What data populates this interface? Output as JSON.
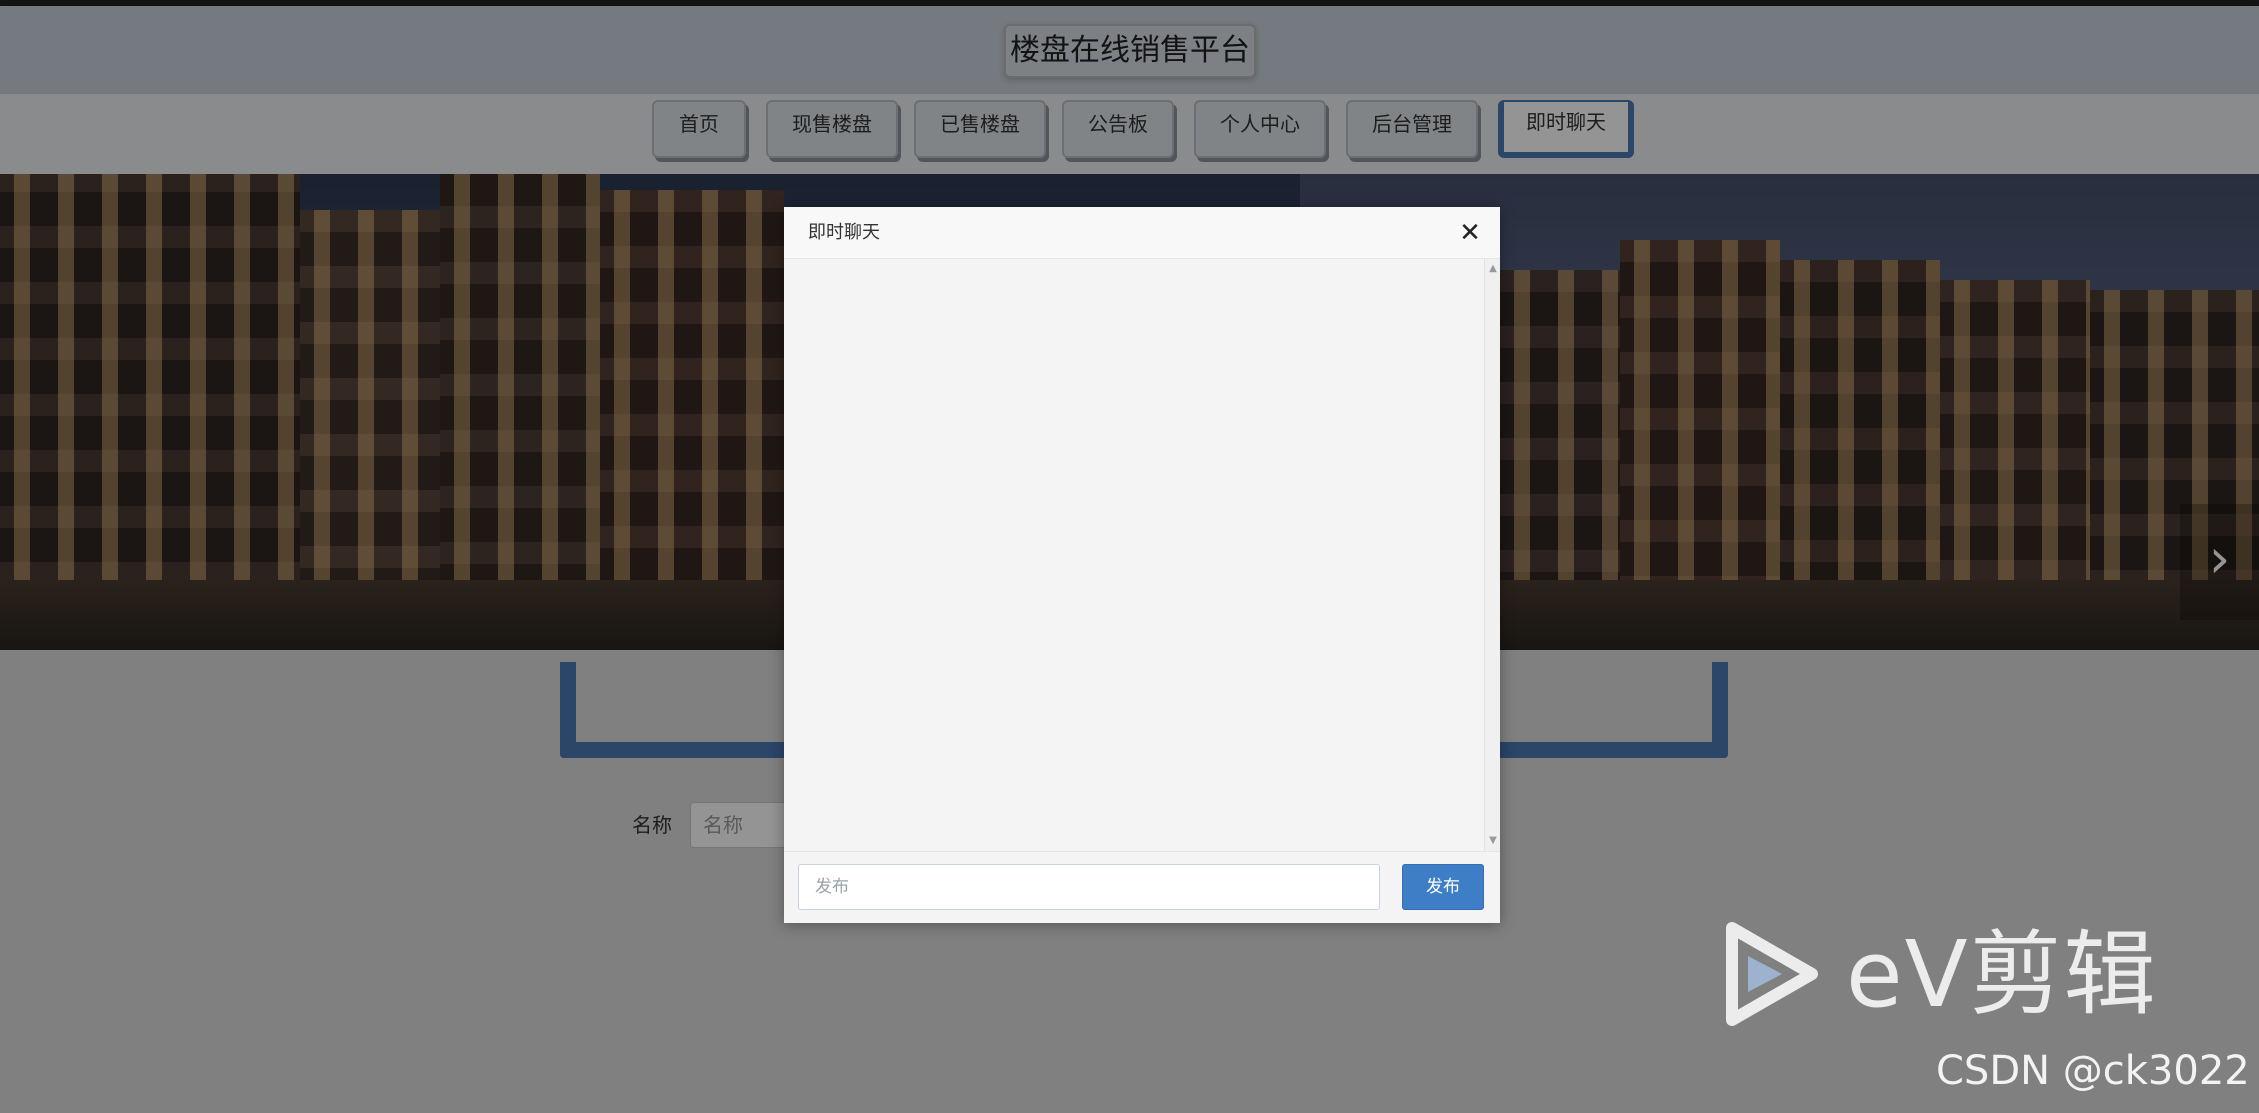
{
  "site": {
    "title": "楼盘在线销售平台"
  },
  "nav": {
    "items": [
      {
        "label": "首页"
      },
      {
        "label": "现售楼盘"
      },
      {
        "label": "已售楼盘"
      },
      {
        "label": "公告板"
      },
      {
        "label": "个人中心"
      },
      {
        "label": "后台管理"
      },
      {
        "label": "即时聊天",
        "active": true
      }
    ]
  },
  "banner": {
    "next_icon": "chevron-right-icon",
    "next_glyph": "›"
  },
  "search": {
    "label": "名称",
    "placeholder": "名称"
  },
  "dialog": {
    "title": "即时聊天",
    "close_glyph": "✕",
    "input_placeholder": "发布",
    "send_label": "发布"
  },
  "watermark": {
    "ev_text": "eV剪辑",
    "csdn_text": "CSDN @ck3022"
  },
  "colors": {
    "accent": "#4a79b5",
    "send_button": "#3e7ec6"
  }
}
